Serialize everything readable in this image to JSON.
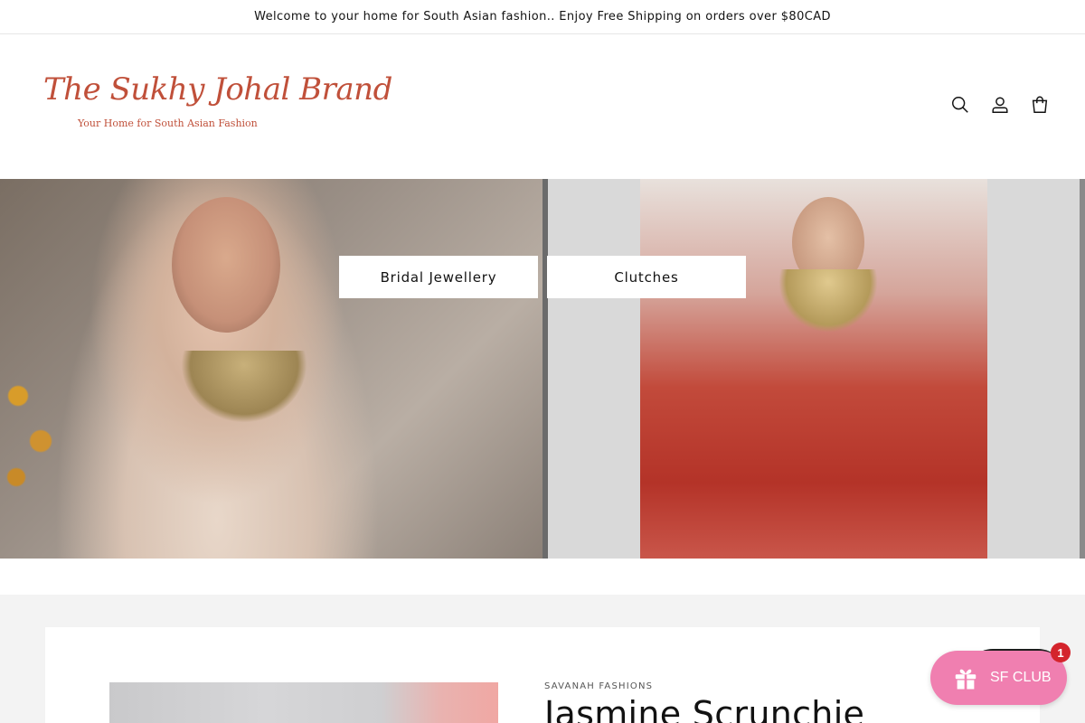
{
  "announcement": {
    "text": "Welcome to your home for South Asian fashion.. Enjoy Free Shipping on orders over $80CAD"
  },
  "header": {
    "logo": {
      "script_text": "The Sukhy Johal Brand",
      "tagline": "Your Home for South Asian Fashion",
      "color": "#c0503a"
    },
    "icons": [
      "search-icon",
      "account-icon",
      "cart-icon"
    ]
  },
  "hero": {
    "buttons": [
      {
        "label": "Bridal Jewellery"
      },
      {
        "label": "Clutches"
      }
    ]
  },
  "product": {
    "vendor": "SAVANAH FASHIONS",
    "title": "Jasmine Scrunchie"
  },
  "rewards_widget": {
    "label": "SF CLUB",
    "badge_count": "1",
    "color": "#f07fb0",
    "icon": "gift-icon"
  }
}
